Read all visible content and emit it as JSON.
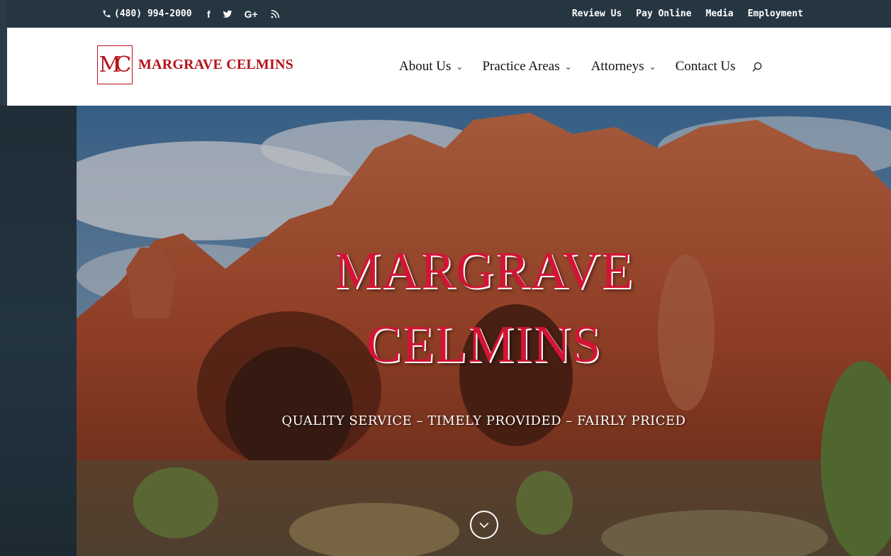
{
  "topbar": {
    "phone": "(480) 994-2000",
    "social": [
      "facebook-icon",
      "twitter-icon",
      "google-plus-icon",
      "rss-icon"
    ],
    "social_labels": {
      "facebook": "f",
      "google": "G+"
    },
    "links": [
      {
        "label": "Review Us"
      },
      {
        "label": "Pay Online"
      },
      {
        "label": "Media"
      },
      {
        "label": "Employment"
      }
    ],
    "background": "#253641"
  },
  "header": {
    "logo_mark": "MC",
    "logo_text": "MARGRAVE CELMINS",
    "brand_color": "#b5121b",
    "nav": [
      {
        "label": "About Us",
        "has_dropdown": true
      },
      {
        "label": "Practice Areas",
        "has_dropdown": true
      },
      {
        "label": "Attorneys",
        "has_dropdown": true
      },
      {
        "label": "Contact Us",
        "has_dropdown": false
      }
    ],
    "chevron": "⌄"
  },
  "hero": {
    "title_line1": "MARGRAVE",
    "title_line2": "CELMINS",
    "tagline": "QUALITY SERVICE – TIMELY PROVIDED – FAIRLY PRICED",
    "title_color": "#d31435"
  }
}
